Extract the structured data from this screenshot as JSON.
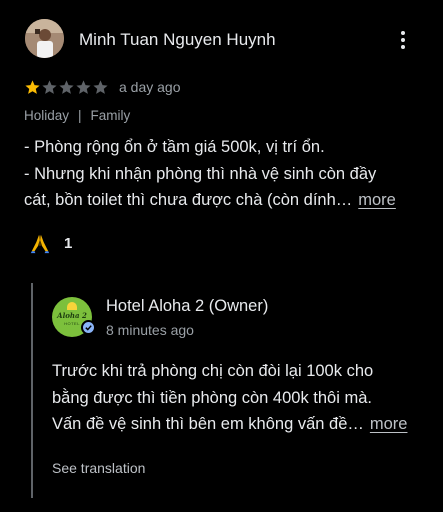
{
  "review": {
    "reviewer_name": "Minh Tuan Nguyen Huynh",
    "rating": 1,
    "max_rating": 5,
    "date": "a day ago",
    "trip_type": "Holiday",
    "separator": "|",
    "travel_group": "Family",
    "text_lines": [
      "- Phòng rộng ổn ở tầm giá 500k, vị trí ổn.",
      "- Nhưng khi nhận phòng thì nhà vệ sinh còn đầy",
      "cát, bồn toilet thì chưa được chà (còn dính…"
    ],
    "more_label": "more",
    "reaction_count": "1",
    "reaction_icon": "folded-hands-icon"
  },
  "owner_reply": {
    "name": "Hotel Aloha 2 (Owner)",
    "time": "8 minutes ago",
    "logo_text": "Aloha 2",
    "logo_sub": "HOTEL",
    "text_lines": [
      "Trước khi trả phòng chị còn đòi lại 100k cho",
      "bằng được thì tiền phòng còn 400k thôi mà.",
      "Vấn đề vệ sinh thì bên em không vấn đề…"
    ],
    "more_label": "more",
    "see_translation": "See translation"
  },
  "colors": {
    "background": "#000000",
    "text": "#e8eaed",
    "muted": "#9aa0a6",
    "star_filled": "#fbbc04",
    "star_empty": "#5f6368",
    "verified": "#8ab4f8"
  }
}
